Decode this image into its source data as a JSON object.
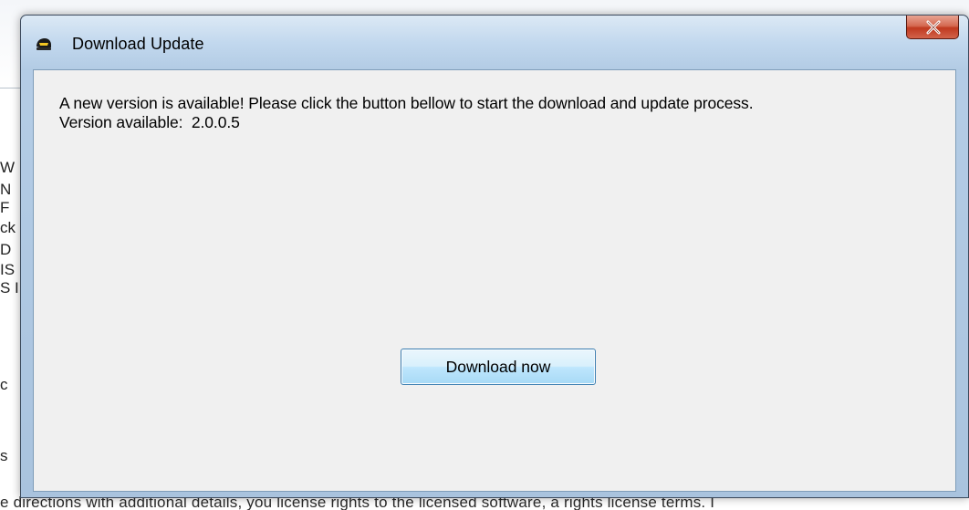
{
  "window": {
    "title": "Download Update",
    "icon": "helmet-icon"
  },
  "message": {
    "line1": "A new version is available! Please click the button bellow to start the download and update process.",
    "version_label": "Version available:",
    "version_value": "2.0.0.5"
  },
  "actions": {
    "download_label": "Download now"
  },
  "background": {
    "left_fragments": [
      "W",
      "N",
      "F",
      "ck",
      "D",
      "IS",
      "S I",
      "c",
      "s"
    ],
    "bottom_text": "e directions with additional details, you license rights to the licensed software, a rights license terms. I"
  },
  "colors": {
    "title_bar": "#c2d8ee",
    "client_bg": "#f0f0f0",
    "close_button": "#c0391f",
    "button_border": "#3c7fb1"
  }
}
